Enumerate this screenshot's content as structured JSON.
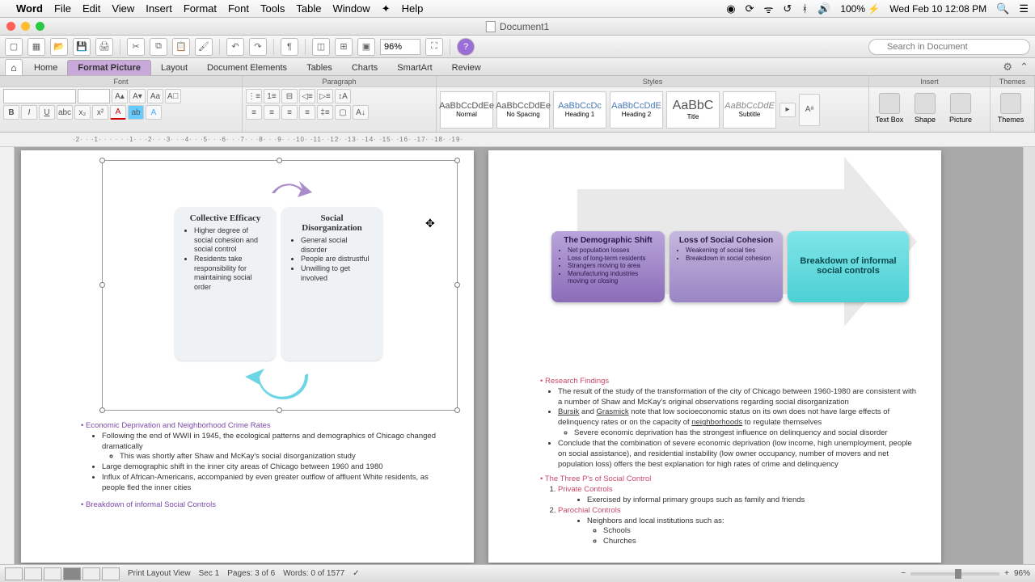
{
  "menubar": {
    "app": "Word",
    "items": [
      "File",
      "Edit",
      "View",
      "Insert",
      "Format",
      "Font",
      "Tools",
      "Table",
      "Window",
      "Help"
    ],
    "battery": "100%",
    "clock": "Wed Feb 10  12:08 PM"
  },
  "window": {
    "title": "Document1"
  },
  "toolbar": {
    "zoom": "96%",
    "search_placeholder": "Search in Document"
  },
  "ribbon": {
    "tabs": [
      "Home",
      "Format Picture",
      "Layout",
      "Document Elements",
      "Tables",
      "Charts",
      "SmartArt",
      "Review"
    ],
    "selected_tab": "Format Picture",
    "groups": [
      "Font",
      "Paragraph",
      "Styles",
      "Insert",
      "Themes"
    ],
    "styles": [
      {
        "preview": "AaBbCcDdEe",
        "name": "Normal"
      },
      {
        "preview": "AaBbCcDdEe",
        "name": "No Spacing"
      },
      {
        "preview": "AaBbCcDc",
        "name": "Heading 1"
      },
      {
        "preview": "AaBbCcDdE",
        "name": "Heading 2"
      },
      {
        "preview": "AaBbC",
        "name": "Title"
      },
      {
        "preview": "AaBbCcDdE",
        "name": "Subtitle"
      }
    ],
    "insert_buttons": [
      "Text Box",
      "Shape",
      "Picture"
    ],
    "themes_button": "Themes"
  },
  "ruler": "·2· · ·1· · · · · ·1· · ·2· · ·3· · ·4· · ·5· · ·6· · ·7· · ·8· · ·9· · ·10· ·11· ·12· ·13· ·14· ·15· ·16· ·17· ·18· ·19·",
  "doc_left": {
    "card1": {
      "title": "Collective Efficacy",
      "bullets": [
        "Higher degree of social cohesion and social control",
        "Residents take responsibility for maintaining social order"
      ]
    },
    "card2": {
      "title": "Social Disorganization",
      "bullets": [
        "General social disorder",
        "People are distrustful",
        "Unwilling to get involved"
      ]
    },
    "heading1": "Economic Deprivation and Neighborhood Crime Rates",
    "b1": "Following the end of WWII in 1945, the ecological patterns and demographics of Chicago changed dramatically",
    "b1a": "This was shortly after Shaw and McKay's social disorganization study",
    "b2": "Large demographic shift in the inner city areas of Chicago between 1960 and 1980",
    "b3": "Influx of African-Americans, accompanied by even greater outflow of affluent White residents, as people fled the inner cities",
    "heading2": "Breakdown of informal Social Controls"
  },
  "doc_right": {
    "box1": {
      "title": "The Demographic Shift",
      "bullets": [
        "Net population losses",
        "Loss of long-term residents",
        "Strangers moving to area",
        "Manufacturing industries moving or closing"
      ]
    },
    "box2": {
      "title": "Loss of Social Cohesion",
      "bullets": [
        "Weakening of social ties",
        "Breakdown in social cohesion"
      ]
    },
    "box3": {
      "title": "Breakdown of informal social controls"
    },
    "heading1": "Research Findings",
    "r1": "The result of the study of the transformation of the city of Chicago between 1960-1980 are consistent with a number of Shaw and McKay's original observations regarding social disorganization",
    "r2a": "Bursik",
    "r2b": " and ",
    "r2c": "Grasmick",
    "r2d": " note that low socioeconomic status on its own does not have large effects of delinquency rates or on the capacity of ",
    "r2e": "neighborhoods",
    "r2f": " to regulate themselves",
    "r2sub": "Severe economic deprivation has the strongest influence on delinquency and social disorder",
    "r3": "Conclude that the combination of severe economic deprivation (low income, high unemployment, people on social assistance), and residential instability (low owner occupancy, number of movers and net population loss) offers the best explanation for high rates of crime and delinquency",
    "heading2": "The Three P's of Social Control",
    "p1": "Private Controls",
    "p1a": "Exercised by informal primary groups such as family and friends",
    "p2": "Parochial Controls",
    "p2a": "Neighbors and local institutions such as:",
    "p2a1": "Schools",
    "p2a2": "Churches"
  },
  "status": {
    "view": "Print Layout View",
    "sec": "Sec   1",
    "pages": "Pages:      3 of 6",
    "words": "Words:      0 of 1577",
    "zoom": "96%"
  }
}
